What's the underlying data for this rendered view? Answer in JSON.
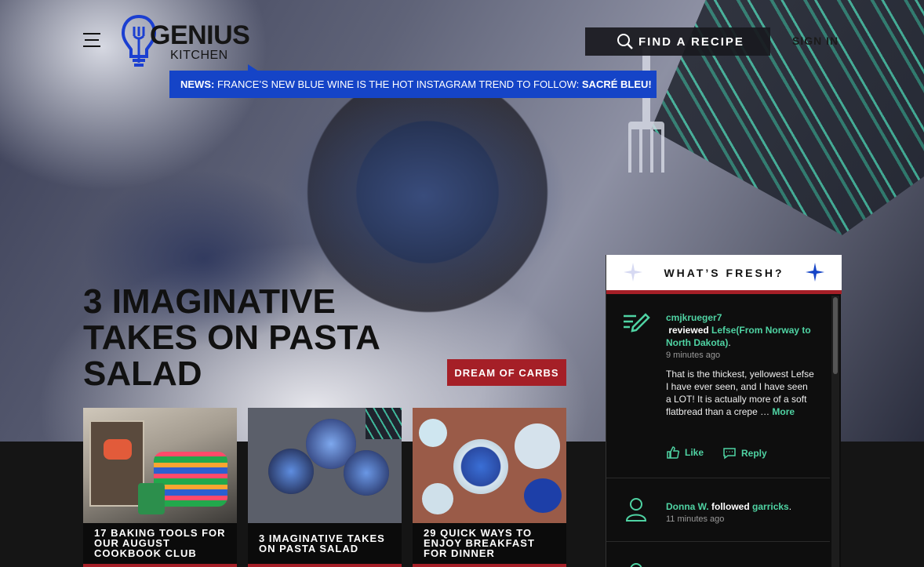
{
  "header": {
    "logo_top": "GENIUS",
    "logo_bottom": "KITCHEN",
    "find_label": "FIND A RECIPE",
    "signin_label": "SIGN IN"
  },
  "news": {
    "prefix": "NEWS:",
    "text": " FRANCE’S NEW BLUE WINE IS THE HOT INSTAGRAM TREND TO FOLLOW: ",
    "suffix": "SACRÉ BLEU!"
  },
  "hero": {
    "headline": "3 IMAGINATIVE TAKES ON PASTA SALAD",
    "cta_label": "DREAM OF CARBS"
  },
  "cards": [
    {
      "title": "17 BAKING TOOLS FOR OUR AUGUST COOKBOOK CLUB"
    },
    {
      "title": "3 IMAGINATIVE TAKES ON PASTA SALAD"
    },
    {
      "title": "29 QUICK WAYS TO ENJOY BREAKFAST FOR DINNER"
    }
  ],
  "fresh": {
    "title": "WHAT’S FRESH?",
    "items": [
      {
        "user": "cmjkrueger7",
        "action": " reviewed ",
        "target": "Lefse(From Norway to North Dakota)",
        "end": ".",
        "time": "9 minutes ago",
        "review": "That is the thickest, yellowest Lefse I have ever seen, and I have seen a LOT! It is actually more of a soft flatbread than a crepe … ",
        "more": "More",
        "like": "Like",
        "reply": "Reply"
      },
      {
        "user": "Donna W.",
        "action": " followed ",
        "target": "garricks",
        "end": ".",
        "time": "11 minutes ago"
      }
    ]
  },
  "colors": {
    "accent_red": "#a51f27",
    "news_blue": "#1544c7",
    "link_green": "#4fd3a3"
  }
}
